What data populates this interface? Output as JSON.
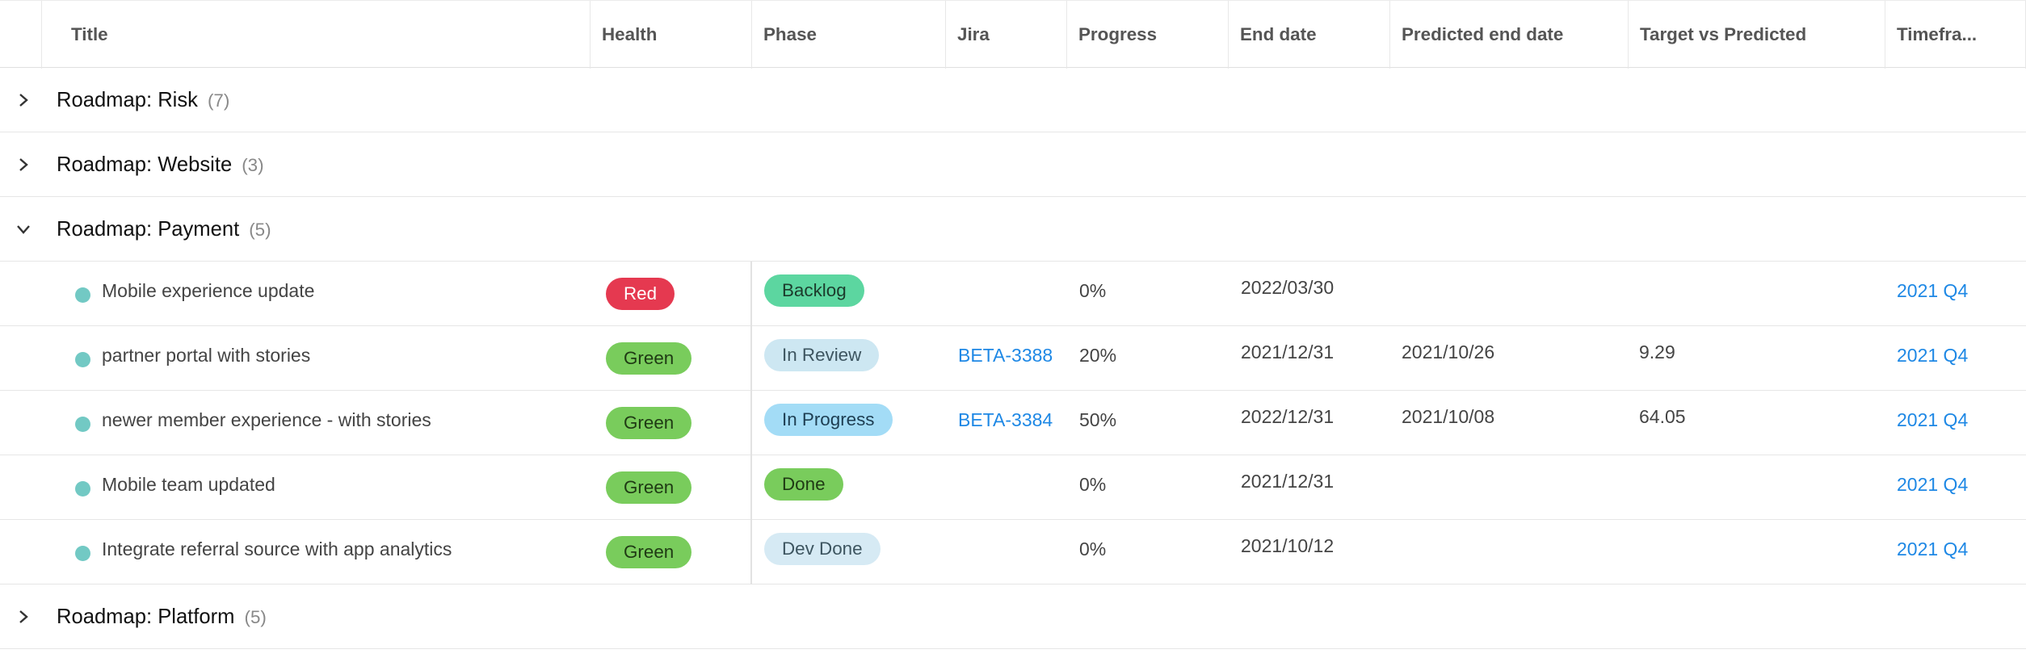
{
  "colors": {
    "red": "#e53950",
    "green": "#79cc5c",
    "backlog": "#5cd6a0",
    "in_review": "#cde7f2",
    "in_progress": "#a3dcf6",
    "done": "#79cc5c",
    "dev_done": "#d6eaf4",
    "link": "#1e88e5",
    "dot": "#72c9c4"
  },
  "header": {
    "columns": [
      "Title",
      "Health",
      "Phase",
      "Jira",
      "Progress",
      "End date",
      "Predicted end date",
      "Target vs Predicted",
      "Timefra..."
    ]
  },
  "groups": [
    {
      "title": "Roadmap: Risk",
      "count": "(7)",
      "expanded": false
    },
    {
      "title": "Roadmap: Website",
      "count": "(3)",
      "expanded": false
    },
    {
      "title": "Roadmap: Payment",
      "count": "(5)",
      "expanded": true
    },
    {
      "title": "Roadmap: Platform",
      "count": "(5)",
      "expanded": false
    }
  ],
  "items": [
    {
      "title": "Mobile experience update",
      "health": "Red",
      "health_color": "red",
      "phase": "Backlog",
      "phase_color": "backlog",
      "jira": "",
      "progress": "0%",
      "end_date": "2022/03/30",
      "predicted_end": "",
      "target_vs_predicted": "",
      "timeframe": "2021 Q4"
    },
    {
      "title": "partner portal with stories",
      "health": "Green",
      "health_color": "green",
      "phase": "In Review",
      "phase_color": "in_review",
      "jira": "BETA-3388",
      "progress": "20%",
      "end_date": "2021/12/31",
      "predicted_end": "2021/10/26",
      "target_vs_predicted": "9.29",
      "timeframe": "2021 Q4"
    },
    {
      "title": "newer member experience - with stories",
      "health": "Green",
      "health_color": "green",
      "phase": "In Progress",
      "phase_color": "in_progress",
      "jira": "BETA-3384",
      "progress": "50%",
      "end_date": "2022/12/31",
      "predicted_end": "2021/10/08",
      "target_vs_predicted": "64.05",
      "timeframe": "2021 Q4"
    },
    {
      "title": "Mobile team updated",
      "health": "Green",
      "health_color": "green",
      "phase": "Done",
      "phase_color": "done",
      "jira": "",
      "progress": "0%",
      "end_date": "2021/12/31",
      "predicted_end": "",
      "target_vs_predicted": "",
      "timeframe": "2021 Q4"
    },
    {
      "title": "Integrate referral source with app analytics",
      "health": "Green",
      "health_color": "green",
      "phase": "Dev Done",
      "phase_color": "dev_done",
      "jira": "",
      "progress": "0%",
      "end_date": "2021/10/12",
      "predicted_end": "",
      "target_vs_predicted": "",
      "timeframe": "2021 Q4"
    }
  ]
}
